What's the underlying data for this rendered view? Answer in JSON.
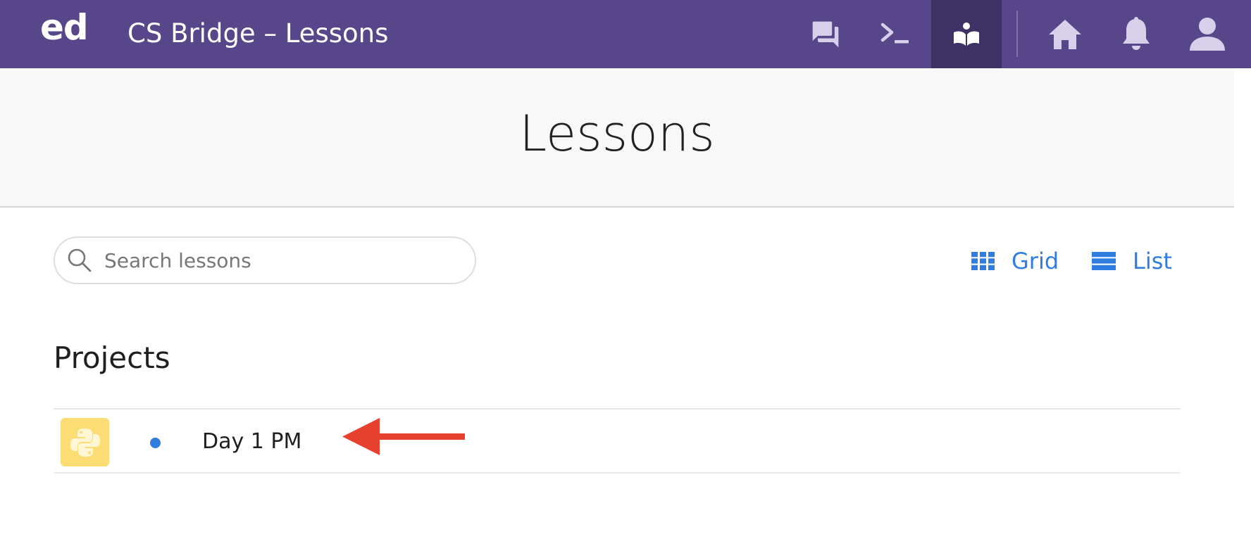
{
  "topbar": {
    "logo": "ed",
    "title": "CS Bridge – Lessons",
    "background_color": "#57468A",
    "active_color": "#3E3163",
    "nav_icons": [
      "discussion-icon",
      "terminal-icon",
      "lessons-book-icon",
      "home-icon",
      "bell-icon",
      "user-icon"
    ],
    "active_nav": "lessons-book-icon"
  },
  "header": {
    "title": "Lessons"
  },
  "search": {
    "placeholder": "Search lessons",
    "value": ""
  },
  "view_toggle": {
    "grid_label": "Grid",
    "list_label": "List",
    "accent_color": "#2F7DE1"
  },
  "sections": [
    {
      "title": "Projects",
      "lessons": [
        {
          "title": "Day 1 PM",
          "icon": "python-icon",
          "status": "unread",
          "thumb_color": "#FBDD74"
        }
      ]
    }
  ],
  "annotation": {
    "icon": "arrow-left-icon",
    "color": "#E8412E"
  }
}
